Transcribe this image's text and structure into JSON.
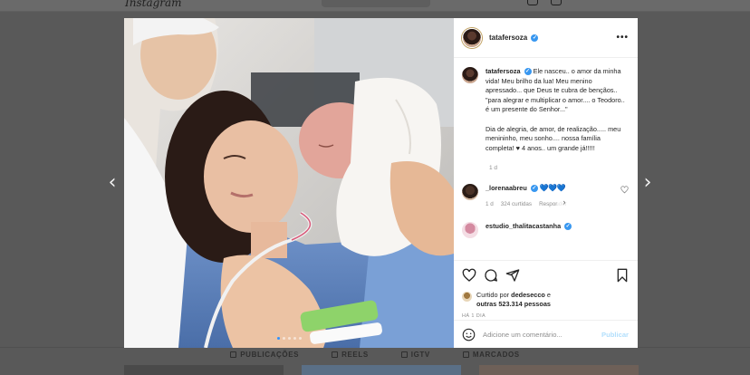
{
  "background": {
    "logo": "Instagram",
    "tabs": [
      {
        "label": "PUBLICAÇÕES"
      },
      {
        "label": "REELS"
      },
      {
        "label": "IGTV"
      },
      {
        "label": "MARCADOS"
      }
    ]
  },
  "carousel": {
    "prev_arrow": "‹",
    "next_arrow": "›",
    "slide_next": "›",
    "slide_count": 5,
    "active_slide": 1
  },
  "post": {
    "username": "tatafersoza",
    "verified_mark": "✓",
    "more_icon": "•••",
    "caption_paragraphs": [
      "Ele nasceu.. o amor da minha vida! Meu brilho da lua! Meu menino apressado... que Deus te cubra de bençãos.. \"para alegrar e multiplicar o amor.... o Teodoro.. é um presente do Senhor...\"",
      "Dia de alegria, de amor, de realização..... meu menininho, meu sonho.... nossa família completa! ♥ 4 anos.. um grande já!!!!!"
    ],
    "caption_time": "1 d",
    "comments": [
      {
        "username": "_lorenaabreu",
        "text": "💙💙💙",
        "time": "1 d",
        "likes": "324 curtidas",
        "reply": "Responder"
      },
      {
        "username": "estudio_thalitacastanha",
        "text": ""
      }
    ],
    "liked_by_prefix": "Curtido por",
    "liked_by_user": "dedesecco",
    "liked_by_suffix": "e",
    "liked_by_others": "outras 523.314 pessoas",
    "date": "HÁ 1 DIA",
    "comment_placeholder": "Adicione um comentário...",
    "publish_label": "Publicar"
  },
  "colors": {
    "verified": "#3897f0",
    "publish_disabled": "#b2dffc",
    "overlay": "#595959",
    "wristband": "#8ed36a"
  },
  "icons": {
    "like": "heart-icon",
    "comment": "comment-icon",
    "share": "share-icon",
    "save": "bookmark-icon",
    "emoji": "emoji-icon",
    "small_like": "heart-outline-icon"
  }
}
